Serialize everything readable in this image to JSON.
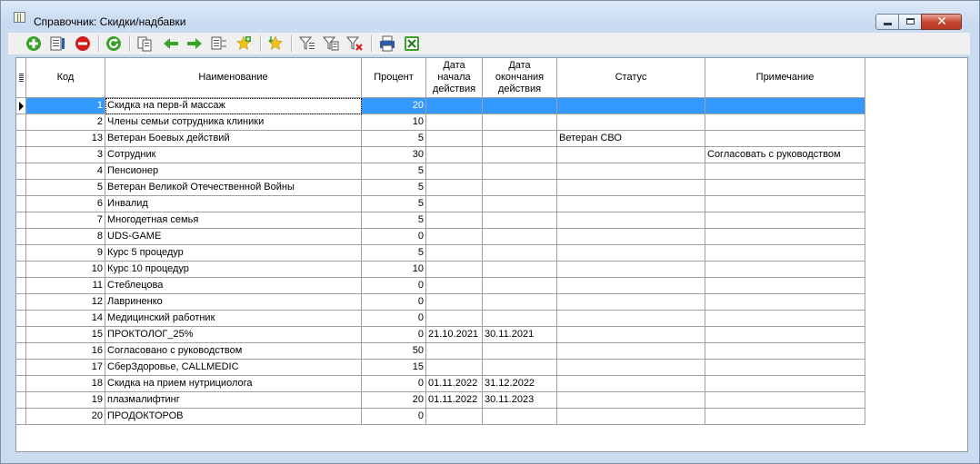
{
  "window": {
    "title": "Справочник: Скидки/надбавки"
  },
  "toolbar": {
    "buttons": [
      {
        "icon": "add-icon"
      },
      {
        "icon": "edit-icon"
      },
      {
        "icon": "delete-icon"
      },
      {
        "icon": "refresh-icon"
      },
      {
        "icon": "copy-icon"
      },
      {
        "icon": "arrow-left-icon"
      },
      {
        "icon": "arrow-right-icon"
      },
      {
        "icon": "move-icon"
      },
      {
        "icon": "add-star-icon"
      },
      {
        "icon": "favorites-icon"
      },
      {
        "icon": "filter-icon"
      },
      {
        "icon": "filter-edit-icon"
      },
      {
        "icon": "filter-clear-icon"
      },
      {
        "icon": "print-icon"
      },
      {
        "icon": "excel-export-icon"
      }
    ],
    "colors": {
      "green": "#3aa12b",
      "red": "#d11b1b",
      "yellow": "#f2c21a",
      "blue": "#2a5caa"
    }
  },
  "grid": {
    "columns": [
      {
        "label": "Код"
      },
      {
        "label": "Наименование"
      },
      {
        "label": "Процент"
      },
      {
        "label": "Дата\nначала\nдействия"
      },
      {
        "label": "Дата\nокончания\nдействия"
      },
      {
        "label": "Статус"
      },
      {
        "label": "Примечание"
      }
    ],
    "selection_color": "#3399ff",
    "rows": [
      {
        "code": "1",
        "name": "Скидка на перв-й массаж",
        "percent": "20",
        "start": "",
        "end": "",
        "status": "",
        "note": ""
      },
      {
        "code": "2",
        "name": "Члены семьи сотрудника клиники",
        "percent": "10",
        "start": "",
        "end": "",
        "status": "",
        "note": ""
      },
      {
        "code": "13",
        "name": "Ветеран Боевых действий",
        "percent": "5",
        "start": "",
        "end": "",
        "status": "Ветеран СВО",
        "note": ""
      },
      {
        "code": "3",
        "name": "Сотрудник",
        "percent": "30",
        "start": "",
        "end": "",
        "status": "",
        "note": "Согласовать с руководством"
      },
      {
        "code": "4",
        "name": "Пенсионер",
        "percent": "5",
        "start": "",
        "end": "",
        "status": "",
        "note": ""
      },
      {
        "code": "5",
        "name": "Ветеран Великой Отечественной Войны",
        "percent": "5",
        "start": "",
        "end": "",
        "status": "",
        "note": ""
      },
      {
        "code": "6",
        "name": "Инвалид",
        "percent": "5",
        "start": "",
        "end": "",
        "status": "",
        "note": ""
      },
      {
        "code": "7",
        "name": "Многодетная семья",
        "percent": "5",
        "start": "",
        "end": "",
        "status": "",
        "note": ""
      },
      {
        "code": "8",
        "name": "UDS-GAME",
        "percent": "0",
        "start": "",
        "end": "",
        "status": "",
        "note": ""
      },
      {
        "code": "9",
        "name": "Курс 5 процедур",
        "percent": "5",
        "start": "",
        "end": "",
        "status": "",
        "note": ""
      },
      {
        "code": "10",
        "name": "Курс 10 процедур",
        "percent": "10",
        "start": "",
        "end": "",
        "status": "",
        "note": ""
      },
      {
        "code": "11",
        "name": "Стеблецова",
        "percent": "0",
        "start": "",
        "end": "",
        "status": "",
        "note": ""
      },
      {
        "code": "12",
        "name": "Лавриненко",
        "percent": "0",
        "start": "",
        "end": "",
        "status": "",
        "note": ""
      },
      {
        "code": "14",
        "name": "Медицинский работник",
        "percent": "0",
        "start": "",
        "end": "",
        "status": "",
        "note": ""
      },
      {
        "code": "15",
        "name": "ПРОКТОЛОГ_25%",
        "percent": "0",
        "start": "21.10.2021",
        "end": "30.11.2021",
        "status": "",
        "note": ""
      },
      {
        "code": "16",
        "name": "Согласовано с руководством",
        "percent": "50",
        "start": "",
        "end": "",
        "status": "",
        "note": ""
      },
      {
        "code": "17",
        "name": "СберЗдоровье, CALLMEDIC",
        "percent": "15",
        "start": "",
        "end": "",
        "status": "",
        "note": ""
      },
      {
        "code": "18",
        "name": "Скидка на прием нутрициолога",
        "percent": "0",
        "start": "01.11.2022",
        "end": "31.12.2022",
        "status": "",
        "note": ""
      },
      {
        "code": "19",
        "name": "плазмалифтинг",
        "percent": "20",
        "start": "01.11.2022",
        "end": "30.11.2023",
        "status": "",
        "note": ""
      },
      {
        "code": "20",
        "name": "ПРОДОКТОРОВ",
        "percent": "0",
        "start": "",
        "end": "",
        "status": "",
        "note": ""
      }
    ]
  }
}
